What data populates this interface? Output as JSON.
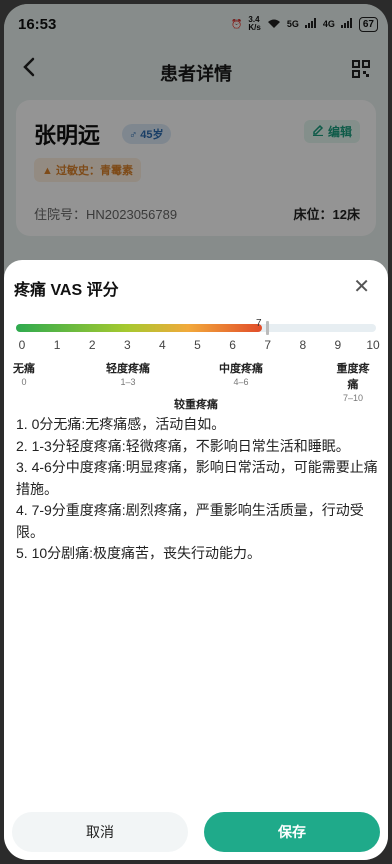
{
  "status_bar": {
    "time": "16:53",
    "speed": "3.4",
    "speed_unit": "K/s",
    "net1": "5G",
    "net2": "4G",
    "battery": "67"
  },
  "header": {
    "title": "患者详情"
  },
  "patient": {
    "name": "张明远",
    "gender_age": "♂ 45岁",
    "edit_label": "编辑",
    "allergy": "过敏史：青霉素",
    "admission": "住院号：HN2023056789",
    "bed": "床位：12床"
  },
  "sheet": {
    "title": "疼痛 VAS 评分",
    "score": 7,
    "score_label": "7",
    "max": 10,
    "ticks": [
      "0",
      "1",
      "2",
      "3",
      "4",
      "5",
      "6",
      "7",
      "8",
      "9",
      "10"
    ],
    "levels": [
      {
        "name": "无痛",
        "range": "0"
      },
      {
        "name": "轻度疼痛",
        "range": "1–3"
      },
      {
        "name": "中度疼痛",
        "range": "4–6"
      },
      {
        "name": "重度疼痛",
        "range": "7–10"
      }
    ],
    "current_level": "较重疼痛",
    "descriptions": [
      "1. 0分无痛:无疼痛感，活动自如。",
      "2. 1-3分轻度疼痛:轻微疼痛，不影响日常生活和睡眠。",
      "3. 4-6分中度疼痛:明显疼痛，影响日常活动，可能需要止痛措施。",
      "4. 7-9分重度疼痛:剧烈疼痛，严重影响生活质量，行动受限。",
      "5. 10分剧痛:极度痛苦，丧失行动能力。"
    ],
    "cancel_label": "取消",
    "save_label": "保存"
  },
  "colors": {
    "accent": "#1faa8a",
    "gradient_start": "#2eaa4f",
    "gradient_end": "#e14c2a"
  }
}
